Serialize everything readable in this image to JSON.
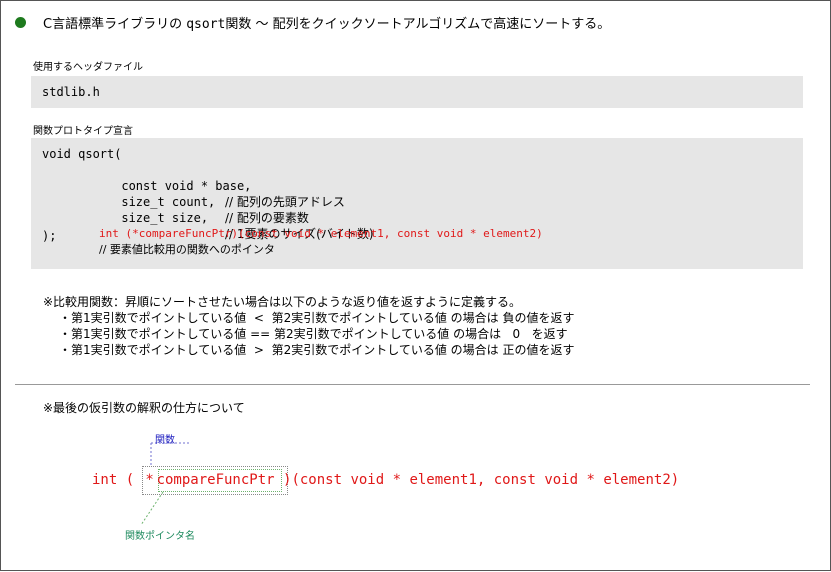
{
  "title": {
    "prefix": "C言語標準ライブラリの ",
    "func": "qsort",
    "suffix": "関数 ～ 配列をクイックソートアルゴリズムで高速にソートする。"
  },
  "header_section": {
    "label": "使用するヘッダファイル",
    "file": "stdlib.h"
  },
  "prototype_section": {
    "label": "関数プロトタイプ宣言",
    "line1": "void qsort(",
    "line2_code": "const void * base,",
    "line2_comment": "// 配列の先頭アドレス",
    "line3_code": "size_t count,",
    "line3_comment": "// 配列の要素数",
    "line4_code": "size_t size,",
    "line4_comment": "// 1要素のサイズ(バイト数)",
    "line5_code": "int (*compareFuncPtr)(const void * element1, const void * element2)",
    "line5_comment": "// 要素値比較用の関数へのポインタ",
    "line6": ");"
  },
  "compare_note": {
    "heading": "※比較用関数：昇順にソートさせたい場合は以下のような返り値を返すように定義する。",
    "rows": [
      "・第1実引数でポイントしている値  <  第2実引数でポイントしている値 の場合は 負の値を返す",
      "・第1実引数でポイントしている値 == 第2実引数でポイントしている値 の場合は   0   を返す",
      "・第1実引数でポイントしている値  >  第2実引数でポイントしている値 の場合は 正の値を返す"
    ]
  },
  "param_note": {
    "heading": "※最後の仮引数の解釈の仕方について",
    "code_prefix": "int ( ",
    "code_star": "*",
    "code_name": "compareFuncPtr",
    "code_suffix": " )(const void * element1, const void * element2)",
    "annotation_func": "関数",
    "annotation_name": "関数ポインタ名"
  },
  "colors": {
    "bullet": "#1e7a1e",
    "code_box": "#e6e6e6",
    "highlight": "#e01818",
    "annotation_func": "#2020c0",
    "annotation_name": "#1e8a5e"
  }
}
